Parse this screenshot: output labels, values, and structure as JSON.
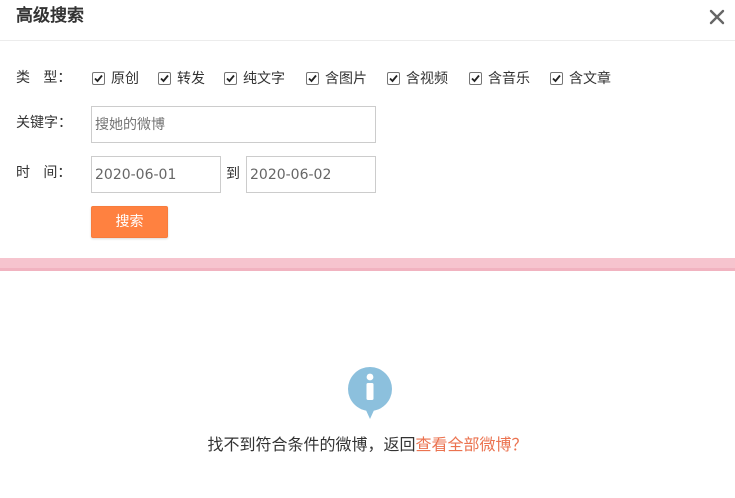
{
  "dialog": {
    "title": "高级搜索",
    "close_icon": "close-icon"
  },
  "type_row": {
    "label": "类   型：",
    "options": [
      {
        "label": "原创",
        "checked": true
      },
      {
        "label": "转发",
        "checked": true
      },
      {
        "label": "纯文字",
        "checked": true
      },
      {
        "label": "含图片",
        "checked": true
      },
      {
        "label": "含视频",
        "checked": true
      },
      {
        "label": "含音乐",
        "checked": true
      },
      {
        "label": "含文章",
        "checked": true
      }
    ]
  },
  "keyword_row": {
    "label": "关键字：",
    "placeholder": "搜她的微博",
    "value": ""
  },
  "time_row": {
    "label": "时   间：",
    "start": "2020-06-01",
    "to_label": "到",
    "end": "2020-06-02"
  },
  "search_button": {
    "label": "搜索"
  },
  "empty_state": {
    "icon": "info-icon",
    "message": "找不到符合条件的微博，返回",
    "link": "查看全部微博？"
  },
  "colors": {
    "accent": "#ff8140",
    "link": "#eb7350",
    "divider": "#f6c4ce",
    "info_icon": "#8cc0dd"
  }
}
